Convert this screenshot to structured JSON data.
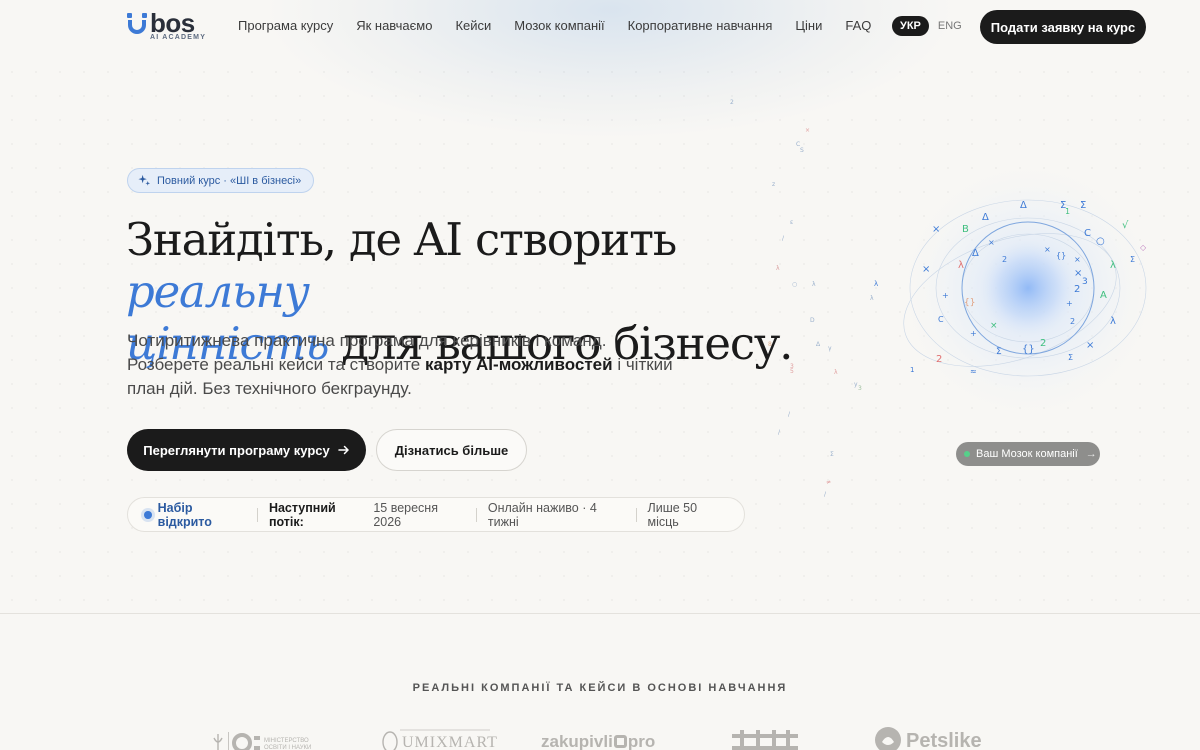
{
  "brand": {
    "word": "bos",
    "sub": "AI ACADEMY"
  },
  "nav": {
    "items": [
      {
        "label": "Програма курсу"
      },
      {
        "label": "Як навчаємо"
      },
      {
        "label": "Кейси"
      },
      {
        "label": "Мозок компанії"
      },
      {
        "label": "Корпоративне навчання"
      },
      {
        "label": "Ціни"
      },
      {
        "label": "FAQ"
      }
    ]
  },
  "lang": {
    "active": "УКР",
    "other": "ENG"
  },
  "header_cta": "Подати заявку на курс",
  "hero": {
    "badge": "Повний курс · «ШІ в бізнесі»",
    "headline_1": "Знайдіть, де AI створить ",
    "headline_accent_1": "реальну",
    "headline_accent_2": "цінність",
    "headline_2": " для вашого бізнесу.",
    "sub_1": "Чотиритижнева практична програма для керівників і команд. Розберете реальні кейси та створите ",
    "sub_bold": "карту AI-можливостей",
    "sub_2": " і чіткий план дій. Без технічного бекграунду.",
    "primary_button": "Переглянути програму курсу",
    "secondary_button": "Дізнатись більше"
  },
  "status": {
    "open": "Набір відкрито",
    "next_label": "Наступний потік:",
    "next_date": "15 вересня 2026",
    "format": "Онлайн наживо · 4 тижні",
    "seats": "Лише 50 місць"
  },
  "brain": {
    "button": "Ваш Мозок компанії",
    "accent_color": "#3d7ad6",
    "green_color": "#3fbf7f"
  },
  "logos": {
    "title": "РЕАЛЬНІ КОМПАНІЇ ТА КЕЙСИ В ОСНОВІ НАВЧАННЯ",
    "ministry": "МІНІСТЕРСТВО ОСВІТИ І НАУКИ",
    "umix": "UMIXMART",
    "zakupivli_a": "zakupivli",
    "zakupivli_b": "pro",
    "petslike": "Petslike"
  },
  "colors": {
    "accent": "#3d7ad6",
    "dark": "#1b1b1b",
    "background": "#f8f7f4"
  }
}
